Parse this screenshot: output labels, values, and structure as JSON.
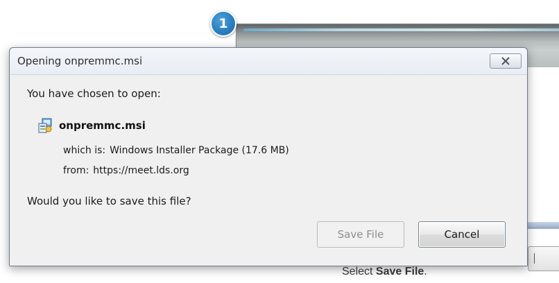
{
  "step_marker": {
    "number": "1",
    "color": "#2a7fc0"
  },
  "dialog": {
    "title": "Opening onpremmc.msi",
    "prompt": "You have chosen to open:",
    "file": {
      "icon": "msi-installer-icon",
      "name": "onpremmc.msi"
    },
    "which_is_label": "which is:",
    "which_is_value": "Windows Installer Package (17.6 MB)",
    "from_label": "from:",
    "from_value": "https://meet.lds.org",
    "question": "Would you like to save this file?",
    "buttons": {
      "save_label": "Save File",
      "save_enabled": false,
      "cancel_label": "Cancel"
    }
  },
  "caption": {
    "prefix": "Select ",
    "emphasis": "Save File",
    "suffix": "."
  }
}
